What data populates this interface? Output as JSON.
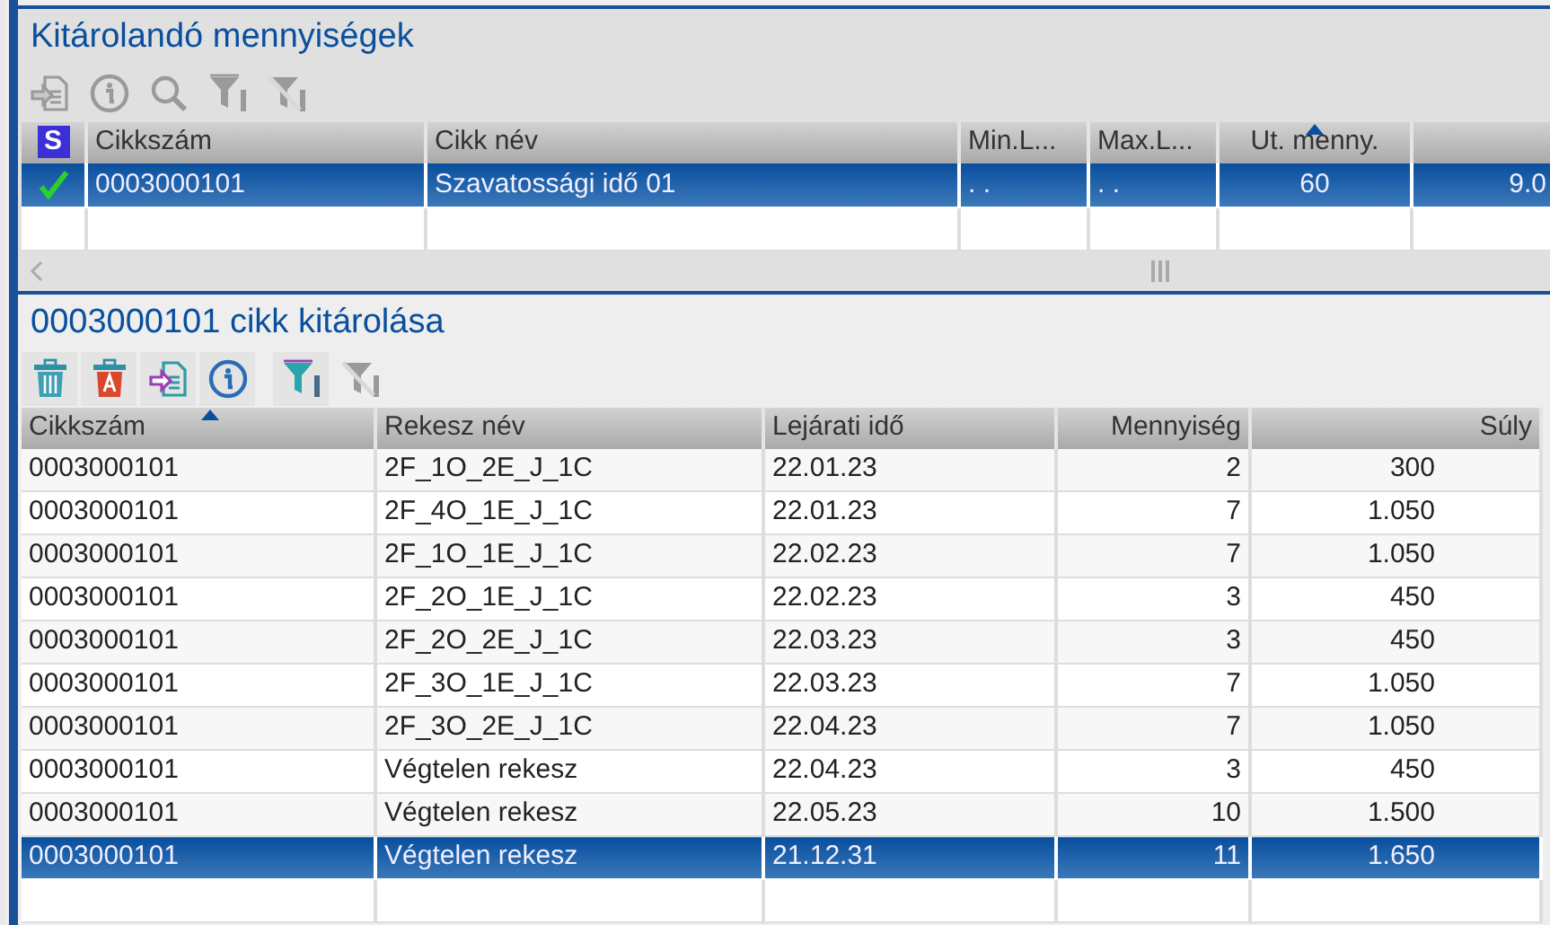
{
  "panels": [
    {
      "title": "Kitárolandó mennyiségek",
      "toolbar": [
        {
          "kind": "import",
          "disabled": true
        },
        {
          "kind": "info",
          "disabled": true
        },
        {
          "kind": "search",
          "disabled": true
        },
        {
          "kind": "filter",
          "disabled": true
        },
        {
          "kind": "filter-clear",
          "disabled": true
        }
      ],
      "table": {
        "columns": [
          {
            "label": "S",
            "kind": "status",
            "sorted": false
          },
          {
            "label": "Cikkszám",
            "kind": "text",
            "sorted": false
          },
          {
            "label": "Cikk név",
            "kind": "text",
            "sorted": false
          },
          {
            "label": "Min.L...",
            "kind": "text",
            "sorted": false
          },
          {
            "label": "Max.L...",
            "kind": "text",
            "sorted": false
          },
          {
            "label": "Ut. menny.",
            "kind": "center",
            "sorted": true
          },
          {
            "kind": "number",
            "sorted": false
          }
        ],
        "rows": [
          {
            "selected": true,
            "checked": true,
            "cells": [
              "",
              "0003000101",
              "Szavatossági idő 01",
              ". .",
              ". .",
              "60",
              "9.0"
            ]
          }
        ]
      },
      "scrollbar": true
    },
    {
      "title": "0003000101 cikk kitárolása",
      "toolbar": [
        {
          "kind": "delete",
          "disabled": false
        },
        {
          "kind": "delete-all",
          "disabled": false
        },
        {
          "kind": "import",
          "disabled": false
        },
        {
          "kind": "info",
          "disabled": false
        },
        {
          "kind": "filter",
          "disabled": false
        },
        {
          "kind": "filter-clear",
          "disabled": true
        }
      ],
      "table": {
        "columns": [
          {
            "label": "Cikkszám",
            "kind": "text",
            "sorted": true
          },
          {
            "label": "Rekesz név",
            "kind": "text",
            "sorted": false
          },
          {
            "label": "Lejárati idő",
            "kind": "text",
            "sorted": false
          },
          {
            "label": "Mennyiség",
            "kind": "number",
            "sorted": false
          },
          {
            "label": "Súly",
            "kind": "weight",
            "sorted": false
          }
        ],
        "rows": [
          {
            "selected": false,
            "cells": [
              "0003000101",
              "2F_1O_2E_J_1C",
              "22.01.23",
              "2",
              "300"
            ]
          },
          {
            "selected": false,
            "cells": [
              "0003000101",
              "2F_4O_1E_J_1C",
              "22.01.23",
              "7",
              "1.050"
            ]
          },
          {
            "selected": false,
            "cells": [
              "0003000101",
              "2F_1O_1E_J_1C",
              "22.02.23",
              "7",
              "1.050"
            ]
          },
          {
            "selected": false,
            "cells": [
              "0003000101",
              "2F_2O_1E_J_1C",
              "22.02.23",
              "3",
              "450"
            ]
          },
          {
            "selected": false,
            "cells": [
              "0003000101",
              "2F_2O_2E_J_1C",
              "22.03.23",
              "3",
              "450"
            ]
          },
          {
            "selected": false,
            "cells": [
              "0003000101",
              "2F_3O_1E_J_1C",
              "22.03.23",
              "7",
              "1.050"
            ]
          },
          {
            "selected": false,
            "cells": [
              "0003000101",
              "2F_3O_2E_J_1C",
              "22.04.23",
              "7",
              "1.050"
            ]
          },
          {
            "selected": false,
            "cells": [
              "0003000101",
              "Végtelen rekesz",
              "22.04.23",
              "3",
              "450"
            ]
          },
          {
            "selected": false,
            "cells": [
              "0003000101",
              "Végtelen rekesz",
              "22.05.23",
              "10",
              "1.500"
            ]
          },
          {
            "selected": true,
            "cells": [
              "0003000101",
              "Végtelen rekesz",
              "21.12.31",
              "11",
              "1.650"
            ]
          }
        ]
      },
      "scrollbar": false
    }
  ]
}
